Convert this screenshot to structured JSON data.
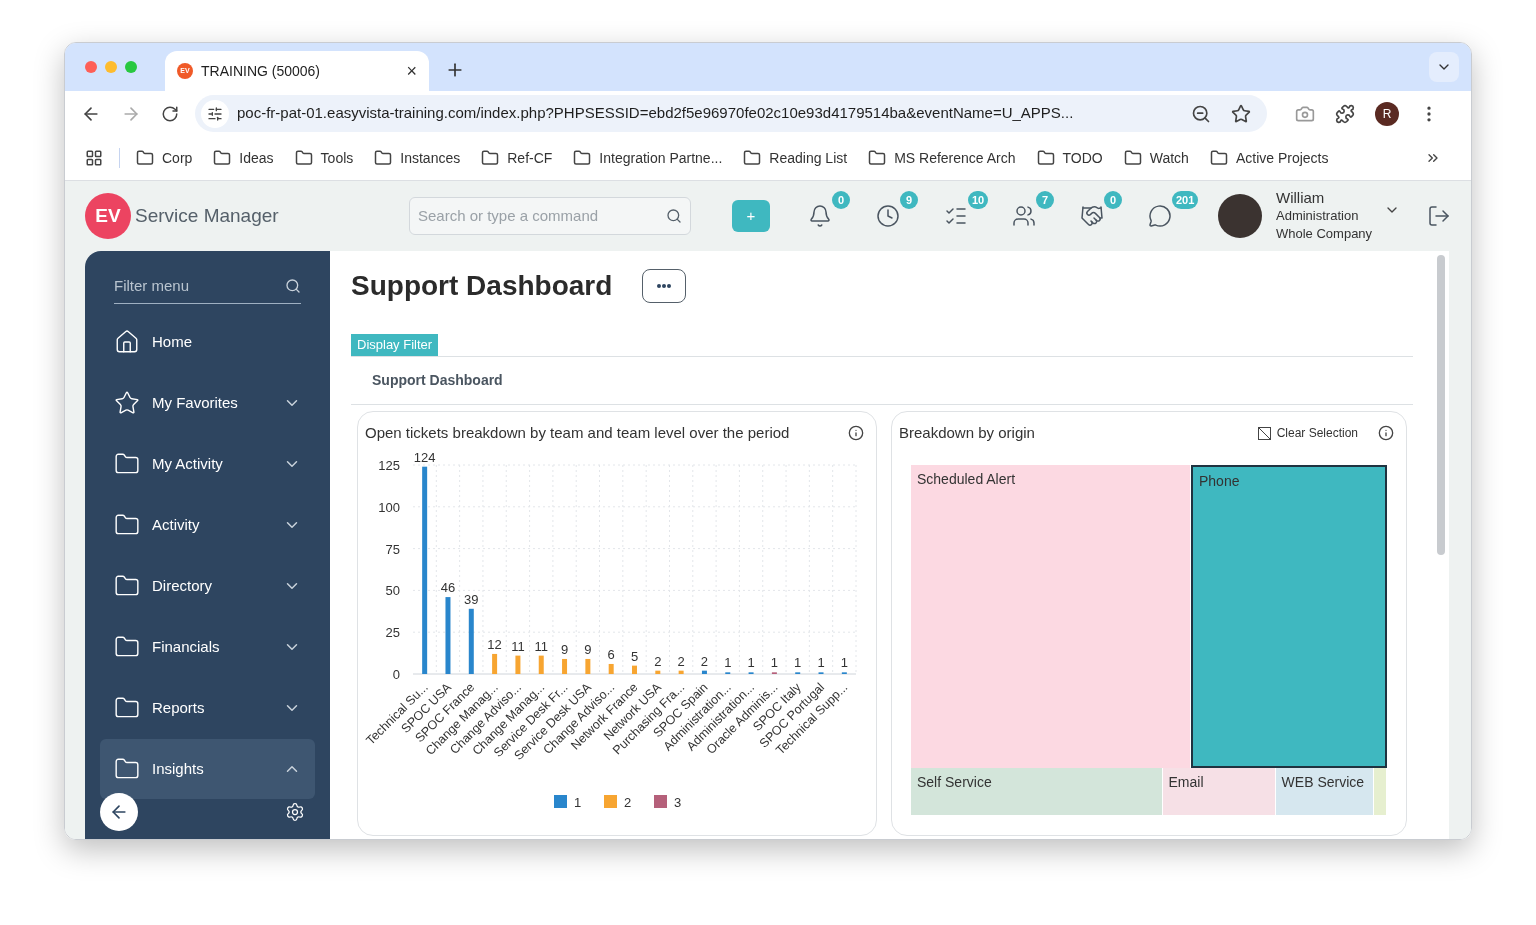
{
  "browser": {
    "tab": {
      "favicon_text": "EV",
      "title": "TRAINING (50006)",
      "close": "×"
    },
    "url": "poc-fr-pat-01.easyvista-training.com/index.php?PHPSESSID=ebd2f5e96970fe02c10e93d4179514ba&eventName=U_APPS...",
    "profile": "R",
    "bookmarks": [
      "Corp",
      "Ideas",
      "Tools",
      "Instances",
      "Ref-CF",
      "Integration Partne...",
      "Reading List",
      "MS Reference Arch",
      "TODO",
      "Watch",
      "Active Projects"
    ]
  },
  "header": {
    "logo": {
      "mark": "EV",
      "text": "Service Manager"
    },
    "search": {
      "placeholder": "Search or type a command"
    },
    "add_button": "+",
    "notifications": [
      {
        "kind": "bell",
        "count": "0"
      },
      {
        "kind": "clock",
        "count": "9"
      },
      {
        "kind": "list",
        "count": "10"
      },
      {
        "kind": "users",
        "count": "7"
      },
      {
        "kind": "handshake",
        "count": "0"
      },
      {
        "kind": "chat",
        "count": "201"
      }
    ],
    "user": {
      "name": "William",
      "role": "Administration",
      "scope": "Whole Company"
    }
  },
  "sidebar": {
    "filter": {
      "placeholder": "Filter menu"
    },
    "items": [
      {
        "label": "Home",
        "kind": "home"
      },
      {
        "label": "My Favorites",
        "kind": "star",
        "expanded": false
      },
      {
        "label": "My Activity",
        "kind": "folder",
        "expanded": false
      },
      {
        "label": "Activity",
        "kind": "folder",
        "expanded": false
      },
      {
        "label": "Directory",
        "kind": "folder",
        "expanded": false
      },
      {
        "label": "Financials",
        "kind": "folder",
        "expanded": false
      },
      {
        "label": "Reports",
        "kind": "folder",
        "expanded": false
      },
      {
        "label": "Insights",
        "kind": "folder",
        "expanded": true
      }
    ]
  },
  "page": {
    "title": "Support Dashboard",
    "filter_tab": "Display Filter",
    "filter_title": "Support Dashboard",
    "bar_card": {
      "title": "Open tickets breakdown by team and team level over the period",
      "chart_data": {
        "type": "bar",
        "categories": [
          "Technical Su...",
          "SPOC USA",
          "SPOC France",
          "Change Manag...",
          "Change Adviso...",
          "Change Manag...",
          "Service Desk Fr...",
          "Service Desk USA",
          "Change Adviso...",
          "Network France",
          "Network USA",
          "Purchasing Fra...",
          "SPOC Spain",
          "Administration...",
          "Administration...",
          "Oracle Adminis...",
          "SPOC Italy",
          "SPOC Portugal",
          "Technical Supp..."
        ],
        "series": [
          {
            "name": "1",
            "color": "#2986cc",
            "values": [
              124,
              46,
              39,
              null,
              null,
              null,
              null,
              null,
              null,
              null,
              null,
              null,
              2,
              1,
              1,
              null,
              1,
              1,
              1
            ]
          },
          {
            "name": "2",
            "color": "#f7a531",
            "values": [
              null,
              null,
              null,
              12,
              11,
              11,
              9,
              9,
              6,
              5,
              2,
              2,
              null,
              null,
              null,
              null,
              null,
              null,
              null
            ]
          },
          {
            "name": "3",
            "color": "#b5607a",
            "values": [
              null,
              null,
              null,
              null,
              null,
              null,
              null,
              null,
              null,
              null,
              null,
              null,
              null,
              null,
              null,
              1,
              null,
              null,
              null
            ]
          }
        ],
        "ylim": [
          0,
          125
        ],
        "yticks": [
          0,
          25,
          50,
          75,
          100,
          125
        ],
        "data_labels": true,
        "grid": true,
        "legend": true
      }
    },
    "treemap_card": {
      "title": "Breakdown by origin",
      "clear": "Clear Selection",
      "top": [
        {
          "label": "Scheduled Alert",
          "color": "#fcd9e2",
          "selected": false
        },
        {
          "label": "Phone",
          "color": "#3fb8c0",
          "selected": true
        }
      ],
      "bottom": [
        {
          "label": "Self Service",
          "color": "#d3e5da",
          "selected": false
        },
        {
          "label": "Email",
          "color": "#f6e0e6",
          "selected": false
        },
        {
          "label": "WEB Service",
          "color": "#d6e7ef",
          "selected": false
        },
        {
          "color": "#e6efcf",
          "selected": false
        }
      ]
    }
  }
}
